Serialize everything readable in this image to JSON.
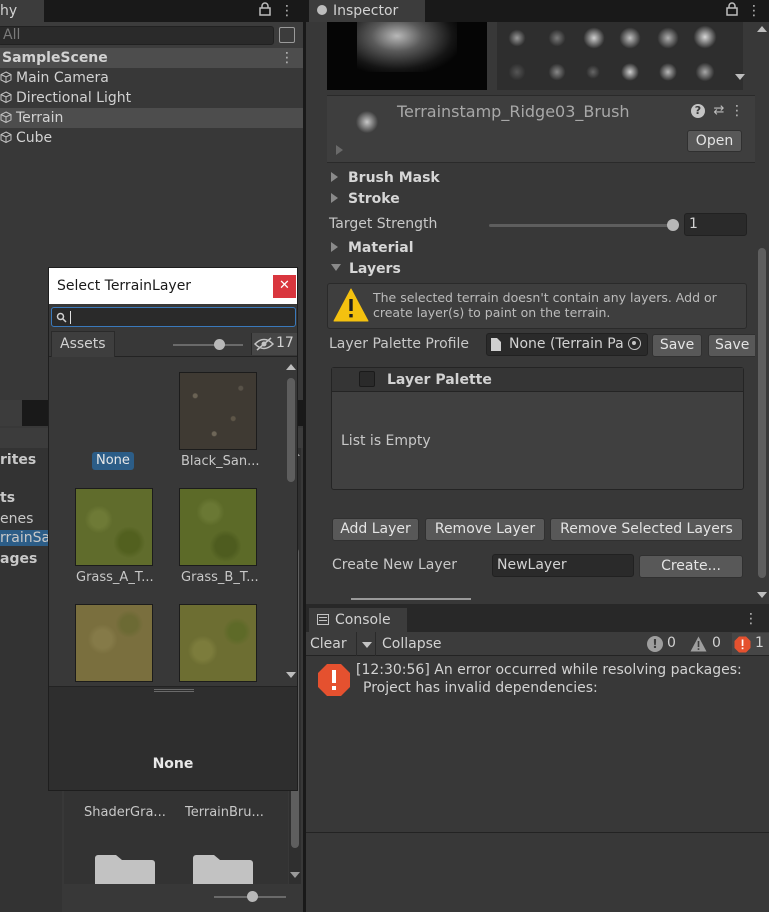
{
  "hierarchy": {
    "tab_label": "hy",
    "search_placeholder": "All",
    "scene_name": "SampleScene",
    "items": [
      "Main Camera",
      "Directional Light",
      "Terrain",
      "Cube"
    ]
  },
  "project_partial": {
    "sidebar_items": [
      "rites",
      "ts",
      "enes",
      "rrainSa",
      "ages"
    ],
    "assets": [
      "ShaderGra...",
      "TerrainBru..."
    ]
  },
  "inspector": {
    "tab_label": "Inspector",
    "brush_name": "Terrainstamp_Ridge03_Brush",
    "open_button": "Open",
    "foldouts": {
      "brush_mask": "Brush Mask",
      "stroke": "Stroke",
      "material": "Material",
      "layers": "Layers"
    },
    "target_strength": {
      "label": "Target Strength",
      "value": "1",
      "level": 1.0
    },
    "warning_text": "The selected terrain doesn't contain any layers. Add or create layer(s) to paint on the terrain.",
    "palette_profile": {
      "label": "Layer Palette Profile",
      "value": "None (Terrain Pa",
      "save1": "Save",
      "save2": "Save"
    },
    "layer_palette": {
      "header": "Layer Palette",
      "empty_text": "List is Empty"
    },
    "buttons": {
      "add_layer": "Add Layer",
      "remove_layer": "Remove Layer",
      "remove_selected": "Remove Selected Layers"
    },
    "create_new_layer": {
      "label": "Create New Layer",
      "value": "NewLayer",
      "button": "Create..."
    }
  },
  "console": {
    "tab_label": "Console",
    "clear": "Clear",
    "collapse": "Collapse",
    "counts": {
      "info": "0",
      "warning": "0",
      "error": "1"
    },
    "message_line1": "[12:30:56] An error occurred while resolving packages:",
    "message_line2": "Project has invalid dependencies:"
  },
  "popup": {
    "title": "Select TerrainLayer",
    "search_value": "",
    "assets_tab": "Assets",
    "hidden_count": "17",
    "zoom_level": 0.7,
    "items": [
      "None",
      "Black_San...",
      "Grass_A_T...",
      "Grass_B_T..."
    ],
    "preview_label": "None"
  },
  "colors": {
    "background": "#282828",
    "panel": "#383838",
    "selection": "#2c5d87",
    "error": "#e5512f",
    "warning": "#f4c10f",
    "close_button": "#d9363e"
  }
}
